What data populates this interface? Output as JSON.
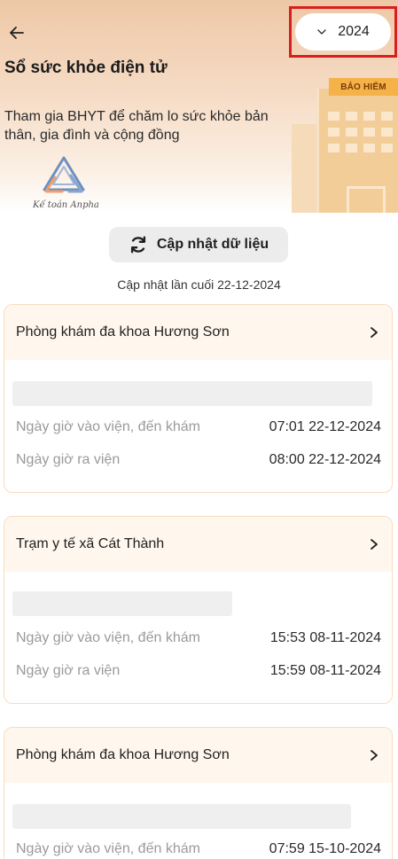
{
  "header": {
    "title": "Sổ sức khỏe điện tử",
    "subtitle": "Tham gia BHYT để chăm lo sức khỏe bản thân, gia đình và cộng đồng",
    "year": "2024",
    "banner_sign": "BẢO HIỂM",
    "logo_text": "Kế toán Anpha"
  },
  "actions": {
    "update_label": "Cập nhật dữ liệu",
    "last_updated": "Cập nhật lần cuối 22-12-2024"
  },
  "records": [
    {
      "facility": "Phòng khám đa khoa Hương Sơn",
      "checkin_label": "Ngày giờ vào viện, đến khám",
      "checkin_value": "07:01 22-12-2024",
      "checkout_label": "Ngày giờ ra viện",
      "checkout_value": "08:00 22-12-2024"
    },
    {
      "facility": "Trạm y tế xã Cát Thành",
      "checkin_label": "Ngày giờ vào viện, đến khám",
      "checkin_value": "15:53 08-11-2024",
      "checkout_label": "Ngày giờ ra viện",
      "checkout_value": "15:59 08-11-2024"
    },
    {
      "facility": "Phòng khám đa khoa Hương Sơn",
      "checkin_label": "Ngày giờ vào viện, đến khám",
      "checkin_value": "07:59 15-10-2024"
    }
  ],
  "colors": {
    "highlight_border": "#d91e1e",
    "card_header_bg": "#fff7ee",
    "card_border": "#f7dcc0"
  },
  "icons": [
    "back-arrow-icon",
    "chevron-down-icon",
    "refresh-icon",
    "chevron-right-icon"
  ]
}
